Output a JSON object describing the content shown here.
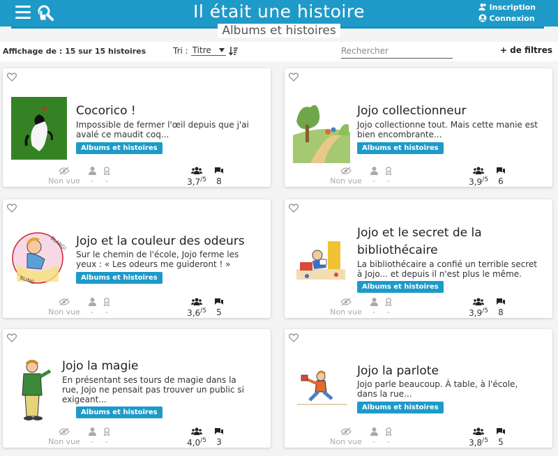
{
  "header": {
    "title": "Il était une histoire",
    "signup_label": "Inscription",
    "login_label": "Connexion",
    "color": "#1e9ac9"
  },
  "page": {
    "heading": "Albums et histoires",
    "count_label": "Affichage de : 15 sur 15 histoires",
    "sort_label": "Tri :",
    "sort_value": "Titre",
    "search_placeholder": "Rechercher",
    "filters_label": "+ de filtres"
  },
  "cards": [
    {
      "title": "Cocorico !",
      "description": "Impossible de fermer l'œil depuis que j'ai avalé ce maudit coq...",
      "badge": "Albums et histoires",
      "view_status": "Non vue",
      "meta1": "-",
      "meta2": "-",
      "rating": "3,7",
      "rating_max": "/5",
      "comments": "8",
      "image_icon": "rooster-image"
    },
    {
      "title": "Jojo collectionneur",
      "description": "Jojo collectionne tout. Mais cette manie est bien encombrante...",
      "badge": "Albums et histoires",
      "view_status": "Non vue",
      "meta1": "-",
      "meta2": "-",
      "rating": "3,9",
      "rating_max": "/5",
      "comments": "6",
      "image_icon": "landscape-image"
    },
    {
      "title": "Jojo et la couleur des odeurs",
      "description": "Sur le chemin de l'école, Jojo ferme les yeux : « Les odeurs me guideront ! »",
      "badge": "Albums et histoires",
      "view_status": "Non vue",
      "meta1": "-",
      "meta2": "-",
      "rating": "3,6",
      "rating_max": "/5",
      "comments": "5",
      "image_icon": "boy-circle-image",
      "image_words": [
        "BLANG!",
        "BLING"
      ]
    },
    {
      "title_line1": "Jojo et le secret de la",
      "title_line2": "bibliothécaire",
      "description": "La bibliothécaire a confié un terrible secret à Jojo... et depuis il n'est plus le même.",
      "badge": "Albums et histoires",
      "view_status": "Non vue",
      "meta1": "-",
      "meta2": "-",
      "rating": "3,9",
      "rating_max": "/5",
      "comments": "8",
      "image_icon": "reading-boy-image"
    },
    {
      "title": "Jojo la magie",
      "description": "En présentant ses tours de magie dans la rue, Jojo ne pensait pas trouver un public si exigeant...",
      "badge": "Albums et histoires",
      "view_status": "Non vue",
      "meta1": "-",
      "meta2": "-",
      "rating": "4,0",
      "rating_max": "/5",
      "comments": "3",
      "image_icon": "magician-image"
    },
    {
      "title": "Jojo la parlote",
      "description": "Jojo parle beaucoup. À table, à l'école, dans la rue...",
      "badge": "Albums et histoires",
      "view_status": "Non vue",
      "meta1": "-",
      "meta2": "-",
      "rating": "3,8",
      "rating_max": "/5",
      "comments": "5",
      "image_icon": "running-boy-image"
    }
  ]
}
